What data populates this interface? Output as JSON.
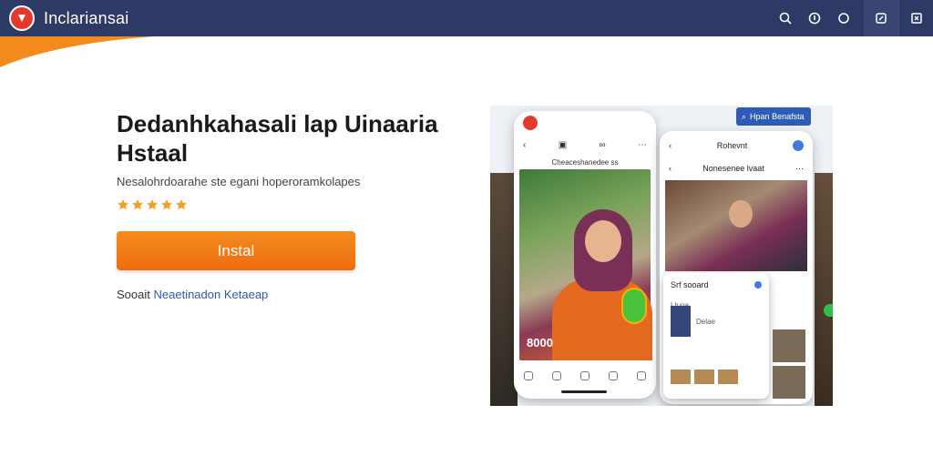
{
  "header": {
    "brand": "Inclariansai",
    "icons": [
      "search-icon",
      "info-icon",
      "circle-icon",
      "export-icon",
      "settings-icon"
    ]
  },
  "hero": {
    "title": "Dedanhkahasali lap Uinaaria Hstaal",
    "subtitle": "Nesalohrdoarahe ste egani hoperoramkolapes",
    "stars": 5,
    "install_label": "Instal",
    "footer_prefix": "Sooait",
    "footer_link": "Neaetinadon Ketaeap"
  },
  "mockup": {
    "search_chip": "Hpan Benafsta",
    "phone1": {
      "caption": "Cheaceshanedee ss",
      "price": "8000"
    },
    "phone2": {
      "title": "Rohevnt",
      "subtitle": "Nonesenee lvaat",
      "card_title": "Srf sooard",
      "card_tab": "Ltuoa",
      "card_row": "Delae"
    }
  },
  "colors": {
    "topbar": "#2e3a66",
    "accent": "#ee6d0e",
    "link": "#2a5db0",
    "star": "#f0a020"
  }
}
